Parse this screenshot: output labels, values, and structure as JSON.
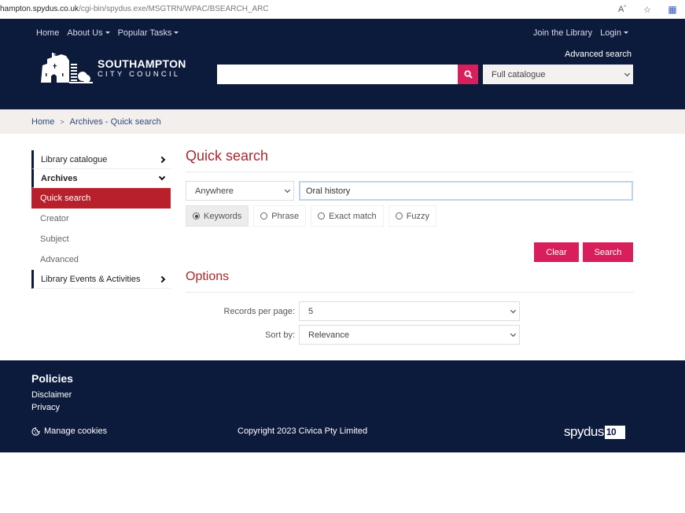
{
  "browser": {
    "url_host": "hampton.spydus.co.uk",
    "url_path": "/cgi-bin/spydus.exe/MSGTRN/WPAC/BSEARCH_ARC",
    "icons": [
      "read-aloud-icon",
      "favorite-star-icon",
      "extension-icon"
    ]
  },
  "header": {
    "nav": {
      "home": "Home",
      "about": "About Us",
      "popular": "Popular Tasks"
    },
    "right_nav": {
      "join": "Join the Library",
      "login": "Login"
    },
    "advanced_search": "Advanced search",
    "logo": {
      "line1": "SOUTHAMPTON",
      "line2": "CITY COUNCIL"
    },
    "search": {
      "value": "",
      "placeholder": ""
    },
    "catalogue_select": "Full catalogue",
    "colors": {
      "navy": "#0c1a3b",
      "accent": "#d81e5b"
    }
  },
  "breadcrumb": {
    "items": [
      "Home",
      "Archives - Quick search"
    ],
    "separator": ">"
  },
  "sidebar": {
    "sections": [
      {
        "label": "Library catalogue",
        "expanded": false
      },
      {
        "label": "Archives",
        "expanded": true,
        "items": [
          {
            "label": "Quick search",
            "active": true
          },
          {
            "label": "Creator",
            "active": false
          },
          {
            "label": "Subject",
            "active": false
          },
          {
            "label": "Advanced",
            "active": false
          }
        ]
      },
      {
        "label": "Library Events & Activities",
        "expanded": false
      }
    ]
  },
  "main": {
    "title": "Quick search",
    "scope_select": "Anywhere",
    "query": "Oral history",
    "match_modes": [
      {
        "label": "Keywords",
        "selected": true
      },
      {
        "label": "Phrase",
        "selected": false
      },
      {
        "label": "Exact match",
        "selected": false
      },
      {
        "label": "Fuzzy",
        "selected": false
      }
    ],
    "clear_label": "Clear",
    "search_label": "Search",
    "options": {
      "title": "Options",
      "records_label": "Records per page:",
      "records_value": "5",
      "sort_label": "Sort by:",
      "sort_value": "Relevance"
    }
  },
  "footer": {
    "title": "Policies",
    "links": [
      "Disclaimer",
      "Privacy"
    ],
    "cookies": "Manage cookies",
    "copyright": "Copyright 2023 Civica Pty Limited",
    "brand": {
      "name": "spydus",
      "version": "10"
    }
  }
}
